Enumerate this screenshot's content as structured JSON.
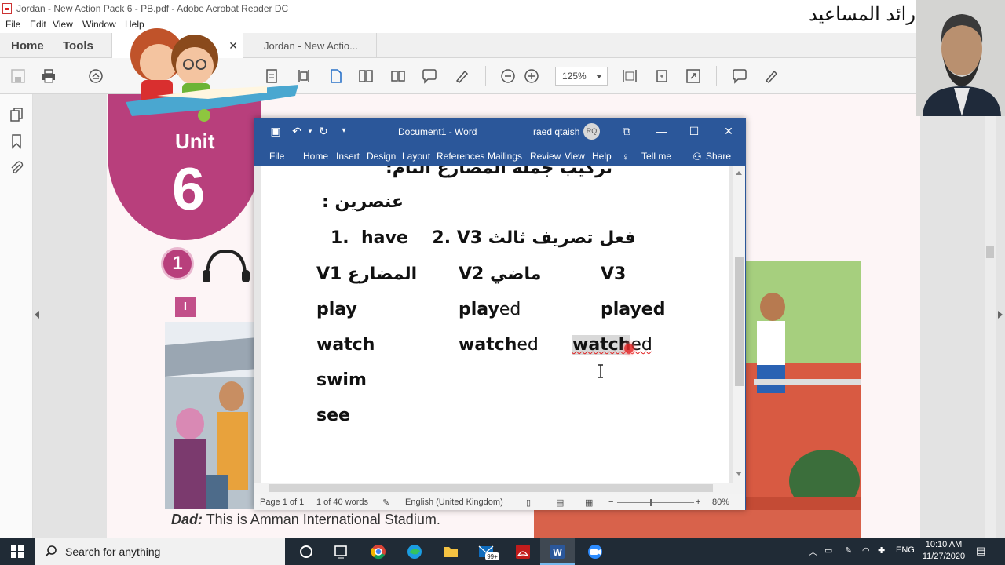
{
  "acrobat": {
    "window_title": "Jordan - New Action Pack 6 - PB.pdf - Adobe Acrobat Reader DC",
    "menu": [
      "File",
      "Edit",
      "View",
      "Window",
      "Help"
    ],
    "tabs": {
      "home": "Home",
      "tools": "Tools",
      "doc_tab": "Jordan - New Actio..."
    },
    "zoom": "125%",
    "page": {
      "unit_label": "Unit",
      "unit_number": "6",
      "section_number": "1",
      "part_label": "I",
      "dad_speaker": "Dad:",
      "dad_text": "This is Amman International Stadium."
    }
  },
  "overlay": {
    "presenter_name": "رائد المساعيد"
  },
  "word": {
    "title": "Document1 - Word",
    "user": "raed qtaish",
    "user_initials": "RQ",
    "ribbon": [
      "File",
      "Home",
      "Insert",
      "Design",
      "Layout",
      "References",
      "Mailings",
      "Review",
      "View",
      "Help",
      "Tell me",
      "Share"
    ],
    "doc": {
      "heading": "تركيب جملة المضارع التام:",
      "elements_label": "عنصرين :",
      "formula_left": "1.  have    2. V3",
      "formula_right": "فعل تصريف ثالث",
      "col_v1": "V1 المضارع",
      "col_v2": "V2 ماضي",
      "col_v3": "V3",
      "rows": [
        {
          "v1": "play",
          "v2_stem": "play",
          "v2_suffix": "ed",
          "v3": "played"
        },
        {
          "v1": "watch",
          "v2_stem": "watch",
          "v2_suffix": "ed",
          "v3_stem": "watch",
          "v3_suffix": "ed"
        },
        {
          "v1": "swim"
        },
        {
          "v1": "see"
        }
      ]
    },
    "status": {
      "page": "Page 1 of 1",
      "words": "1 of 40 words",
      "language": "English (United Kingdom)",
      "zoom": "80%"
    }
  },
  "taskbar": {
    "search_placeholder": "Search for anything",
    "mail_badge": "99+",
    "lang": "ENG",
    "time": "10:10 AM",
    "date": "11/27/2020"
  }
}
